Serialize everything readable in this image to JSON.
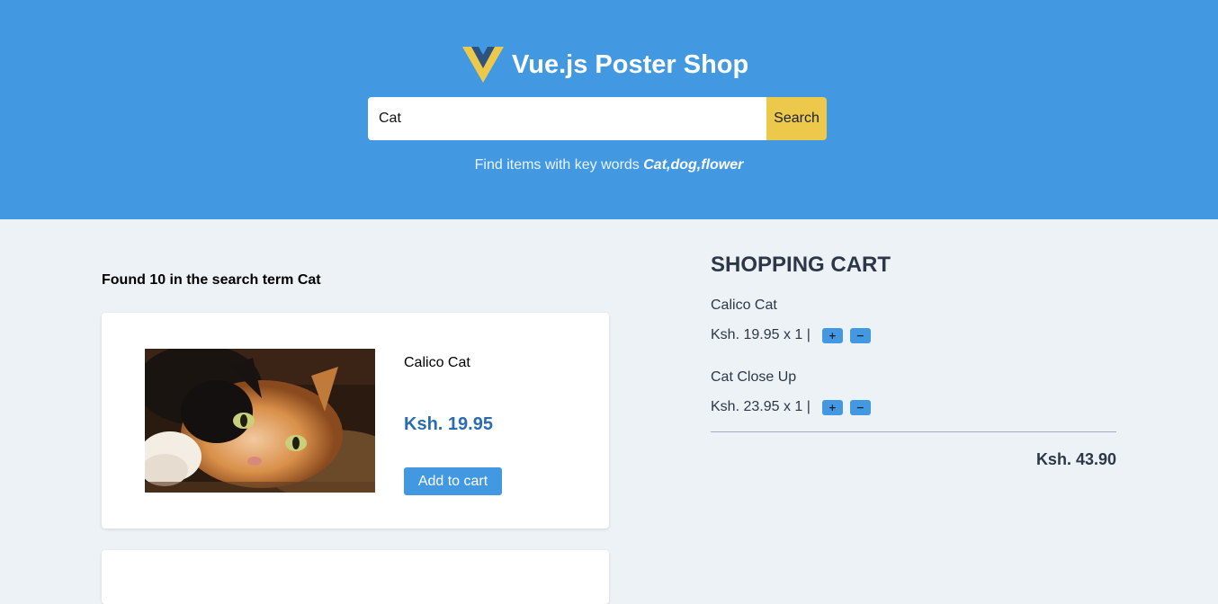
{
  "header": {
    "title": "Vue.js Poster Shop",
    "logo_icon": "vue-logo-icon",
    "background_color": "#4299e1"
  },
  "search": {
    "value": "Cat",
    "placeholder": "",
    "button_label": "Search",
    "button_color": "#ecc94b",
    "hint_prefix": "Find items with key words",
    "hint_keywords": "Cat,dog,flower"
  },
  "results": {
    "summary": "Found 10 in the search term Cat",
    "items": [
      {
        "name": "Calico Cat",
        "price": "Ksh. 19.95",
        "add_label": "Add to cart",
        "image_icon": "calico-cat-photo"
      }
    ]
  },
  "cart": {
    "title": "SHOPPING CART",
    "items": [
      {
        "name": "Calico Cat",
        "price_line": "Ksh. 19.95 x 1 |",
        "plus_label": "+",
        "minus_label": "−"
      },
      {
        "name": "Cat Close Up",
        "price_line": "Ksh. 23.95 x 1 |",
        "plus_label": "+",
        "minus_label": "−"
      }
    ],
    "total": "Ksh. 43.90"
  }
}
